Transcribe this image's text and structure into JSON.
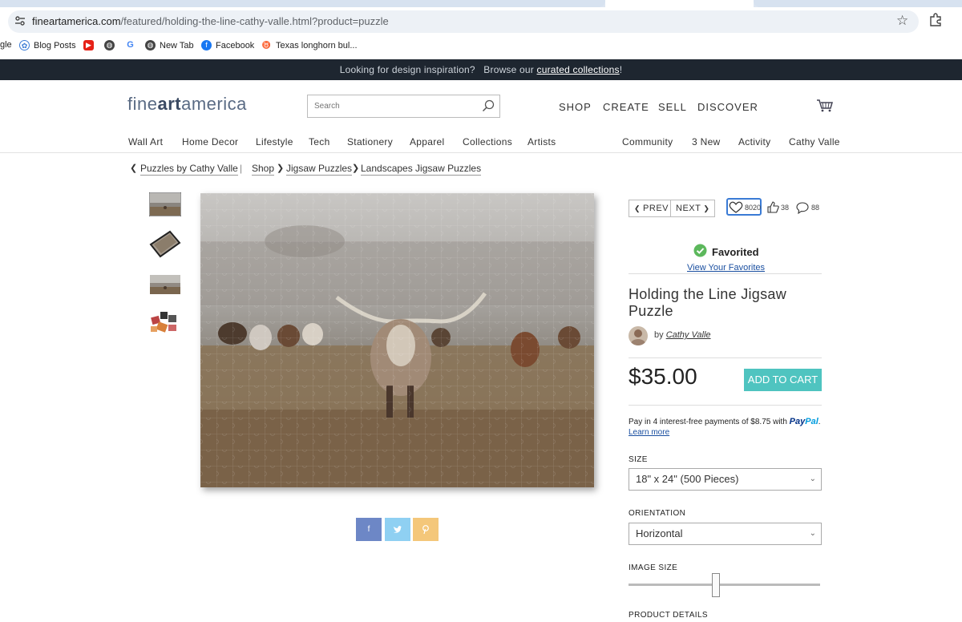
{
  "browser": {
    "url_host": "fineartamerica.com",
    "url_path": "/featured/holding-the-line-cathy-valle.html?product=puzzle",
    "bookmarks": [
      {
        "label": "gle",
        "icon": "none"
      },
      {
        "label": "Blog Posts",
        "icon": "blog-icon"
      },
      {
        "label": "",
        "icon": "youtube-icon"
      },
      {
        "label": "",
        "icon": "globe-icon"
      },
      {
        "label": "",
        "icon": "google-icon"
      },
      {
        "label": "New Tab",
        "icon": "globe-icon"
      },
      {
        "label": "Facebook",
        "icon": "facebook-icon"
      },
      {
        "label": "Texas longhorn bul...",
        "icon": "longhorn-icon"
      }
    ]
  },
  "banner": {
    "prefix": "Looking for design inspiration?   Browse our ",
    "link": "curated collections",
    "suffix": "!"
  },
  "header": {
    "logo_a": "fine",
    "logo_b": "art",
    "logo_c": "america",
    "search_placeholder": "Search",
    "nav": [
      "SHOP",
      "CREATE",
      "SELL",
      "DISCOVER"
    ],
    "categories": [
      "Wall Art",
      "Home Decor",
      "Lifestyle",
      "Tech",
      "Stationery",
      "Apparel",
      "Collections",
      "Artists"
    ],
    "user_links": [
      "Community",
      "3 New",
      "Activity",
      "Cathy Valle"
    ]
  },
  "breadcrumb": {
    "back": "Puzzles by Cathy Valle",
    "separator": "|",
    "items": [
      "Shop",
      "Jigsaw Puzzles",
      "Landscapes Jigsaw Puzzles"
    ]
  },
  "product": {
    "prev": "PREV",
    "next": "NEXT",
    "favorites_count": "8020",
    "likes_count": "38",
    "comments_count": "88",
    "favorited_label": "Favorited",
    "view_favorites": "View Your Favorites",
    "title": "Holding the Line Jigsaw Puzzle",
    "by": "by",
    "artist": "Cathy Valle",
    "price": "$35.00",
    "add_to_cart": "ADD TO CART",
    "paypal_text": "Pay in 4 interest-free payments of $8.75 with",
    "paypal_brand_a": "Pay",
    "paypal_brand_b": "Pal",
    "learn_more": "Learn more",
    "size_label": "SIZE",
    "size_value": "18\" x 24\" (500 Pieces)",
    "orientation_label": "ORIENTATION",
    "orientation_value": "Horizontal",
    "image_size_label": "IMAGE SIZE",
    "image_size_level": 0.5,
    "product_details_label": "PRODUCT DETAILS"
  },
  "share": [
    {
      "label": "f",
      "icon": "facebook-share-icon",
      "color": "#6d87c6"
    },
    {
      "label": "t",
      "icon": "twitter-share-icon",
      "color": "#8fd0f2"
    },
    {
      "label": "p",
      "icon": "pinterest-share-icon",
      "color": "#f4c77a"
    }
  ],
  "colors": {
    "banner_bg": "#1e2630",
    "accent": "#4fc4c0",
    "favorite_border": "#3a7bd5"
  }
}
